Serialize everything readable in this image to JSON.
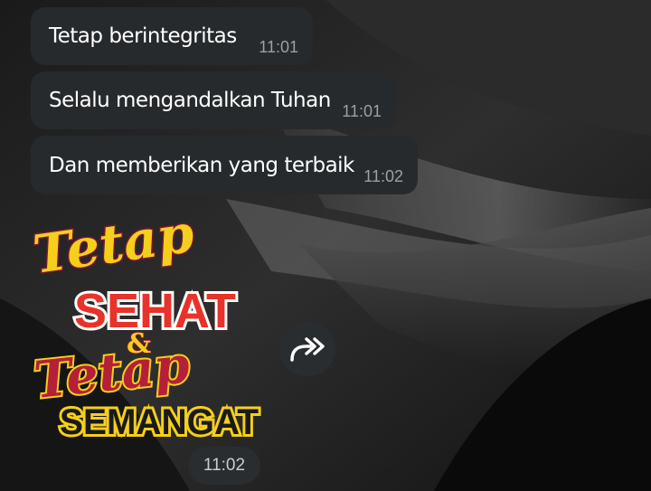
{
  "messages": [
    {
      "text": "Tetap berintegritas",
      "time": "11:01"
    },
    {
      "text": "Selalu mengandalkan Tuhan",
      "time": "11:01"
    },
    {
      "text": "Dan memberikan yang terbaik",
      "time": "11:02"
    }
  ],
  "sticker": {
    "line1": "Tetap",
    "line2": "SEHAT",
    "amp": "&",
    "line3": "Tetap",
    "line4": "SEMANGAT",
    "time": "11:02"
  },
  "icons": {
    "forward": "forward-icon"
  },
  "colors": {
    "bubble": "#262a2d",
    "timestamp": "#9aa0a4",
    "sticker_yellow": "#f5cf1b",
    "sticker_red": "#e8322a",
    "sticker_maroon": "#7a1636"
  }
}
